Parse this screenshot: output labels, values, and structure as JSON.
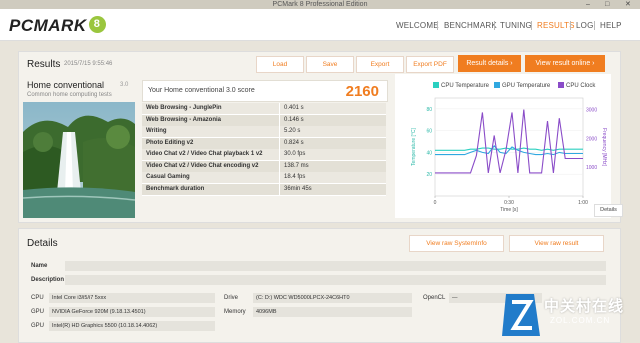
{
  "window": {
    "title": "PCMark 8 Professional Edition",
    "min": "–",
    "max": "□",
    "close": "✕"
  },
  "nav": {
    "logo": "PCMARK",
    "logo_badge": "8",
    "items": [
      "WELCOME",
      "BENCHMARK",
      "TUNING",
      "RESULTS",
      "LOG",
      "HELP"
    ],
    "active": "RESULTS"
  },
  "results": {
    "heading": "Results",
    "date": "2015/7/15 9:55:46",
    "buttons": {
      "load": "Load",
      "save": "Save",
      "export": "Export",
      "export_pdf": "Export PDF",
      "result_details": "Result details  ›",
      "view_online": "View result online  ›"
    },
    "test": {
      "title": "Home conventional",
      "version": "3.0",
      "subtitle": "Common home computing tests"
    },
    "score_label": "Your Home conventional 3.0 score",
    "score": "2160",
    "rows": [
      {
        "k": "Web Browsing - JunglePin",
        "v": "0.401 s"
      },
      {
        "k": "Web Browsing - Amazonia",
        "v": "0.146 s"
      },
      {
        "k": "Writing",
        "v": "5.20 s"
      },
      {
        "k": "Photo Editing v2",
        "v": "0.824 s"
      },
      {
        "k": "Video Chat v2 / Video Chat playback 1 v2",
        "v": "30.0 fps"
      },
      {
        "k": "Video Chat v2 / Video Chat encoding v2",
        "v": "138.7 ms"
      },
      {
        "k": "Casual Gaming",
        "v": "18.4 fps"
      },
      {
        "k": "Benchmark duration",
        "v": "36min 45s"
      }
    ],
    "details_button": "Details"
  },
  "chart_data": {
    "type": "line",
    "legend": [
      "CPU Temperature",
      "GPU Temperature",
      "CPU Clock"
    ],
    "colors": {
      "cpu_temp": "#2bd0c0",
      "gpu_temp": "#30a8e0",
      "cpu_clock": "#8a4cc8"
    },
    "ylabel_left": "Temperature [°C]",
    "ylabel_right": "Frequency [MHz]",
    "xlabel": "Time [s]",
    "x_ticks": [
      "0",
      "0:30",
      "1:00"
    ],
    "y_left_ticks": [
      "20",
      "40",
      "60",
      "80"
    ],
    "y_right_ticks": [
      "1000",
      "2000",
      "3000"
    ],
    "ylim_left": [
      0,
      90
    ],
    "ylim_right": [
      0,
      3400
    ],
    "x": [
      0,
      0.04,
      0.08,
      0.12,
      0.16,
      0.2,
      0.24,
      0.28,
      0.32,
      0.36,
      0.4,
      0.44,
      0.48,
      0.52,
      0.56,
      0.6,
      0.64,
      0.68,
      0.72,
      0.76,
      0.8,
      0.84,
      0.88,
      0.92,
      0.96,
      1.0
    ],
    "series": [
      {
        "name": "CPU Temperature",
        "values": [
          42,
          42,
          42,
          42,
          42,
          42,
          43,
          43,
          44,
          44,
          43,
          43,
          44,
          43,
          43,
          44,
          43,
          43,
          42,
          43,
          42,
          43,
          43,
          43,
          43,
          43
        ]
      },
      {
        "name": "GPU Temperature",
        "values": [
          38,
          38,
          38,
          38,
          38,
          38,
          40,
          42,
          40,
          39,
          46,
          40,
          39,
          45,
          42,
          40,
          39,
          38,
          38,
          39,
          38,
          40,
          39,
          39,
          39,
          39
        ]
      },
      {
        "name": "CPU Clock",
        "values": [
          800,
          800,
          800,
          800,
          800,
          800,
          800,
          1400,
          2900,
          800,
          2100,
          800,
          1600,
          2900,
          800,
          3000,
          800,
          800,
          800,
          2600,
          800,
          2700,
          1300,
          1300,
          1300,
          1300
        ],
        "axis": "right"
      }
    ]
  },
  "details": {
    "heading": "Details",
    "btn_sysinfo": "View raw SystemInfo",
    "btn_raw": "View raw result",
    "name_label": "Name",
    "desc_label": "Description",
    "cpu_label": "CPU",
    "cpu": "Intel Core i3/i5/i7 5xxx",
    "gpu1_label": "GPU",
    "gpu1": "NVIDIA GeForce 920M (9.18.13.4501)",
    "gpu2_label": "GPU",
    "gpu2": "Intel(R) HD Graphics 5500 (10.18.14.4062)",
    "drive_label": "Drive",
    "drive": "(C: D:) WDC WD5000LPCX-24C6HT0",
    "memory_label": "Memory",
    "memory": "4096MB",
    "opencl_label": "OpenCL",
    "opencl": "—"
  },
  "watermark": {
    "text": "中关村在线",
    "url": "ZOL.COM.CN"
  }
}
